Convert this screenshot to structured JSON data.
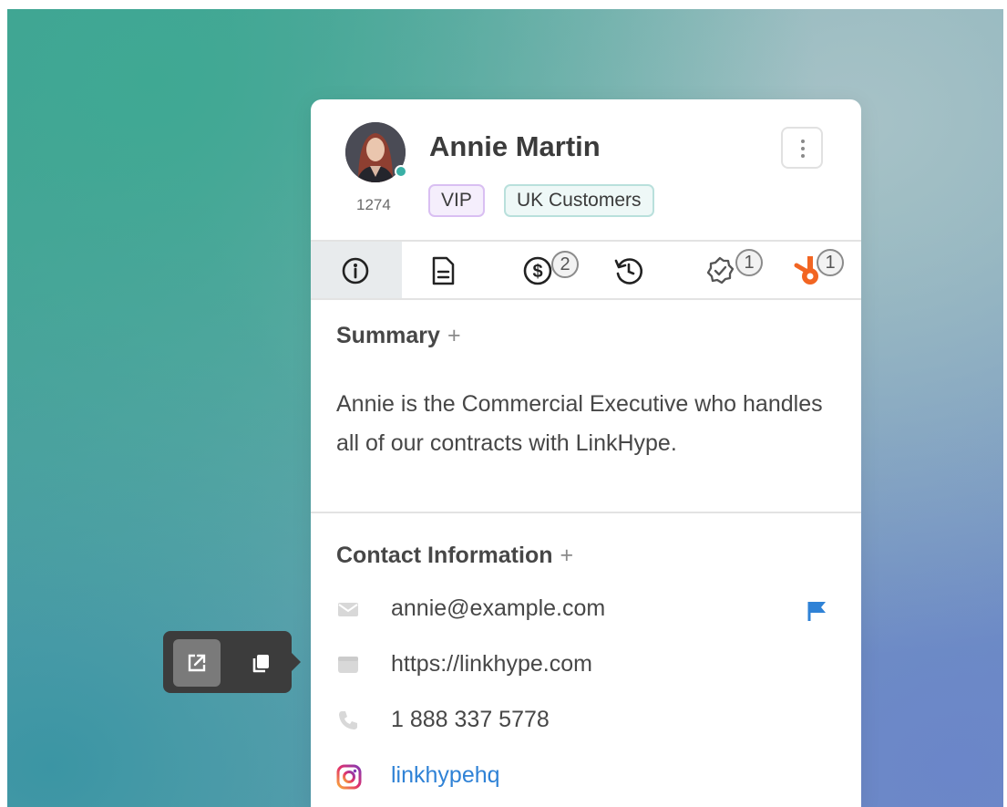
{
  "contact": {
    "name": "Annie Martin",
    "id": "1274",
    "tags": [
      "VIP",
      "UK Customers"
    ]
  },
  "tabs": [
    {
      "icon": "info-icon",
      "badge": ""
    },
    {
      "icon": "document-icon",
      "badge": ""
    },
    {
      "icon": "dollar-icon",
      "badge": "2"
    },
    {
      "icon": "history-icon",
      "badge": ""
    },
    {
      "icon": "verified-icon",
      "badge": "1"
    },
    {
      "icon": "hubspot-icon",
      "badge": "1"
    }
  ],
  "summary": {
    "title": "Summary",
    "add_label": "+",
    "text": "Annie is the Commercial Executive who handles all of our contracts with LinkHype."
  },
  "contact_info": {
    "title": "Contact Information",
    "add_label": "+",
    "email": "annie@example.com",
    "website": "https://linkhype.com",
    "phone": "1 888 337 5778",
    "instagram": "linkhypehq"
  },
  "colors": {
    "status_online": "#3ab0a6",
    "link": "#2f82d6",
    "hubspot": "#f26522",
    "vip_tag": "#d9bff2",
    "uk_tag": "#b9e0dc"
  }
}
